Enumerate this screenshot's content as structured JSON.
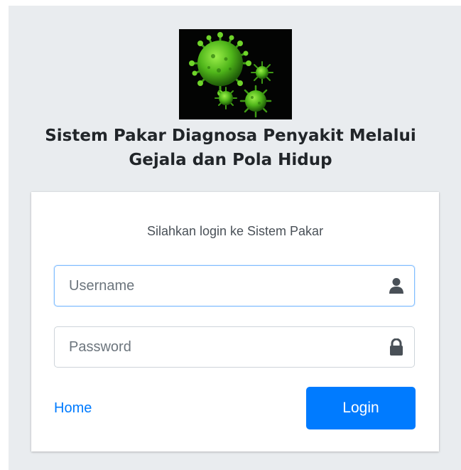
{
  "header": {
    "title_line1": "Sistem Pakar Diagnosa Penyakit Melalui",
    "title_line2": "Gejala dan Pola Hidup"
  },
  "login": {
    "message": "Silahkan login ke Sistem Pakar",
    "username_placeholder": "Username",
    "password_placeholder": "Password",
    "home_label": "Home",
    "login_label": "Login"
  },
  "colors": {
    "background": "#e9ecef",
    "card": "#ffffff",
    "primary": "#007bff",
    "virus_green": "#5cc41e"
  },
  "icons": {
    "logo": "virus-logo",
    "username": "user-icon",
    "password": "lock-icon"
  }
}
